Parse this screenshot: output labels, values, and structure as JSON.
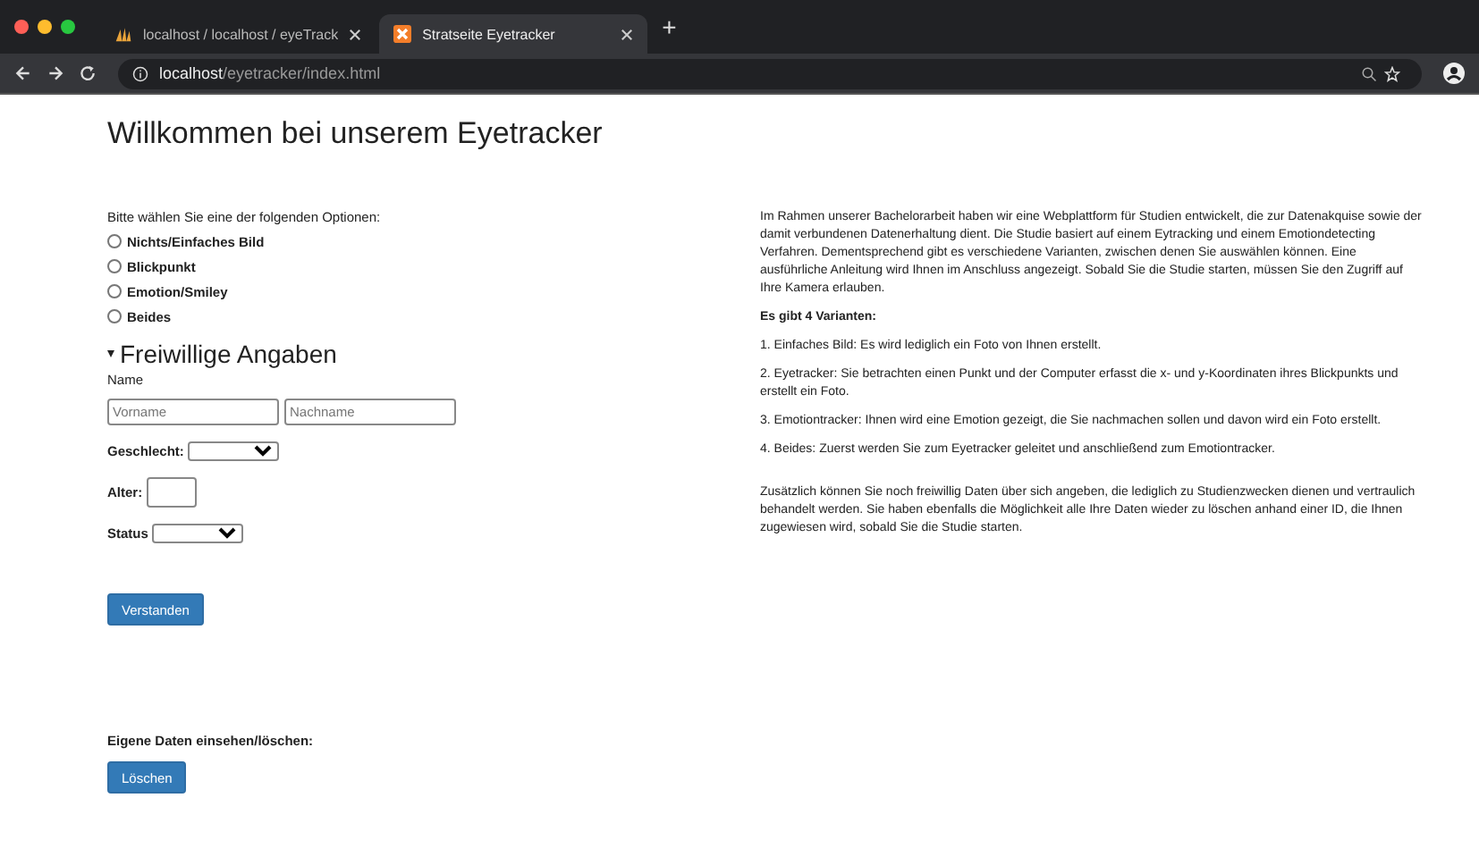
{
  "browser": {
    "tabs": [
      {
        "title": "localhost / localhost / eyeTrack",
        "selected": false,
        "kind": "pma"
      },
      {
        "title": "Stratseite Eyetracker",
        "selected": true,
        "kind": "xampp"
      }
    ],
    "new_tab": "+",
    "url_host": "localhost",
    "url_path": "/eyetracker/index.html"
  },
  "page": {
    "title": "Willkommen bei unserem Eyetracker",
    "prompt": "Bitte wählen Sie eine der folgenden Optionen:",
    "options": [
      {
        "label": "Nichts/Einfaches Bild",
        "selected": false
      },
      {
        "label": "Blickpunkt",
        "selected": false
      },
      {
        "label": "Emotion/Smiley",
        "selected": false
      },
      {
        "label": "Beides",
        "selected": false
      }
    ],
    "optional": {
      "title": "Freiwillige Angaben",
      "expanded": true,
      "name_label": "Name",
      "first_placeholder": "Vorname",
      "last_placeholder": "Nachname",
      "gender_label": "Geschlecht:",
      "age_label": "Alter:",
      "status_label": "Status"
    },
    "submit": "Verstanden",
    "own_data_label": "Eigene Daten einsehen/löschen:",
    "delete": "Löschen",
    "info": [
      "Im Rahmen unserer Bachelorarbeit haben wir eine Webplattform für Studien entwickelt, die zur Datenakquise sowie der damit verbundenen Datenerhaltung dient. Die Studie basiert auf einem Eytracking und einem Emotiondetecting Verfahren. Dementsprechend gibt es verschiedene Varianten, zwischen denen Sie auswählen können. Eine ausführliche Anleitung wird Ihnen im Anschluss angezeigt. Sobald Sie die Studie starten, müssen Sie den Zugriff auf Ihre Kamera erlauben.",
      "**Es gibt 4 Varianten:**",
      "1. Einfaches Bild: Es wird lediglich ein Foto von Ihnen erstellt.",
      "2. Eyetracker: Sie betrachten einen Punkt und der Computer erfasst die x- und y-Koordinaten ihres Blickpunkts und erstellt ein Foto.",
      "3. Emotiontracker: Ihnen wird eine Emotion gezeigt, die Sie nachmachen sollen und davon wird ein Foto erstellt.",
      "4. Beides: Zuerst werden Sie zum Eyetracker geleitet und anschließend zum Emotiontracker."
    ],
    "footer_info": "Zusätzlich können Sie noch freiwillig Daten über sich angeben, die lediglich zu Studienzwecken dienen und vertraulich behandelt werden. Sie haben ebenfalls die Möglichkeit alle Ihre Daten wieder zu löschen anhand einer ID, die Ihnen zugewiesen wird, sobald Sie die Studie starten."
  }
}
